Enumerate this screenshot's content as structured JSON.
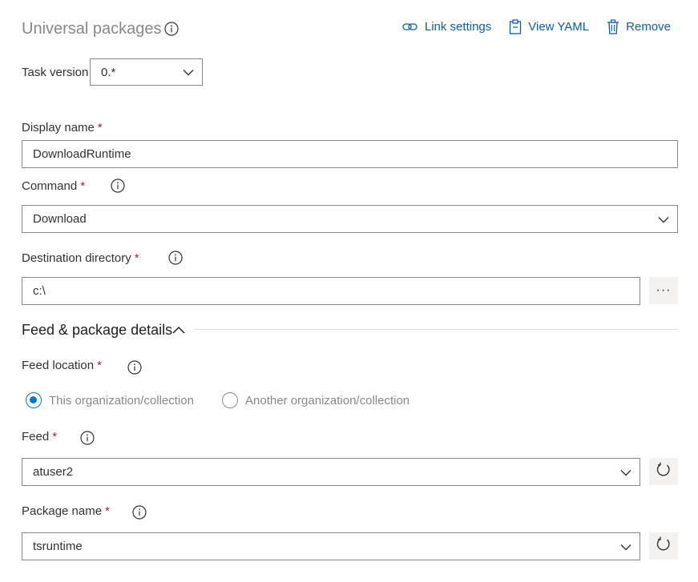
{
  "header": {
    "title": "Universal packages",
    "actions": [
      {
        "label": "Link settings",
        "icon": "link-icon"
      },
      {
        "label": "View YAML",
        "icon": "clipboard-icon"
      },
      {
        "label": "Remove",
        "icon": "trash-icon"
      }
    ]
  },
  "task_version": {
    "label": "Task version",
    "value": "0.*"
  },
  "display_name": {
    "label": "Display name",
    "required": "*",
    "value": "DownloadRuntime"
  },
  "command": {
    "label": "Command",
    "required": "*",
    "value": "Download"
  },
  "destination": {
    "label": "Destination directory",
    "required": "*",
    "value": "c:\\",
    "browse": "···"
  },
  "section": {
    "title": "Feed & package details"
  },
  "feed_location": {
    "label": "Feed location",
    "required": "*",
    "options": [
      "This organization/collection",
      "Another organization/collection"
    ],
    "selected": 0
  },
  "feed": {
    "label": "Feed",
    "required": "*",
    "value": "atuser2"
  },
  "package_name": {
    "label": "Package name",
    "required": "*",
    "value": "tsruntime"
  },
  "colors": {
    "accent": "#0078d4",
    "link": "#0b5cad",
    "required": "#a4262c"
  }
}
